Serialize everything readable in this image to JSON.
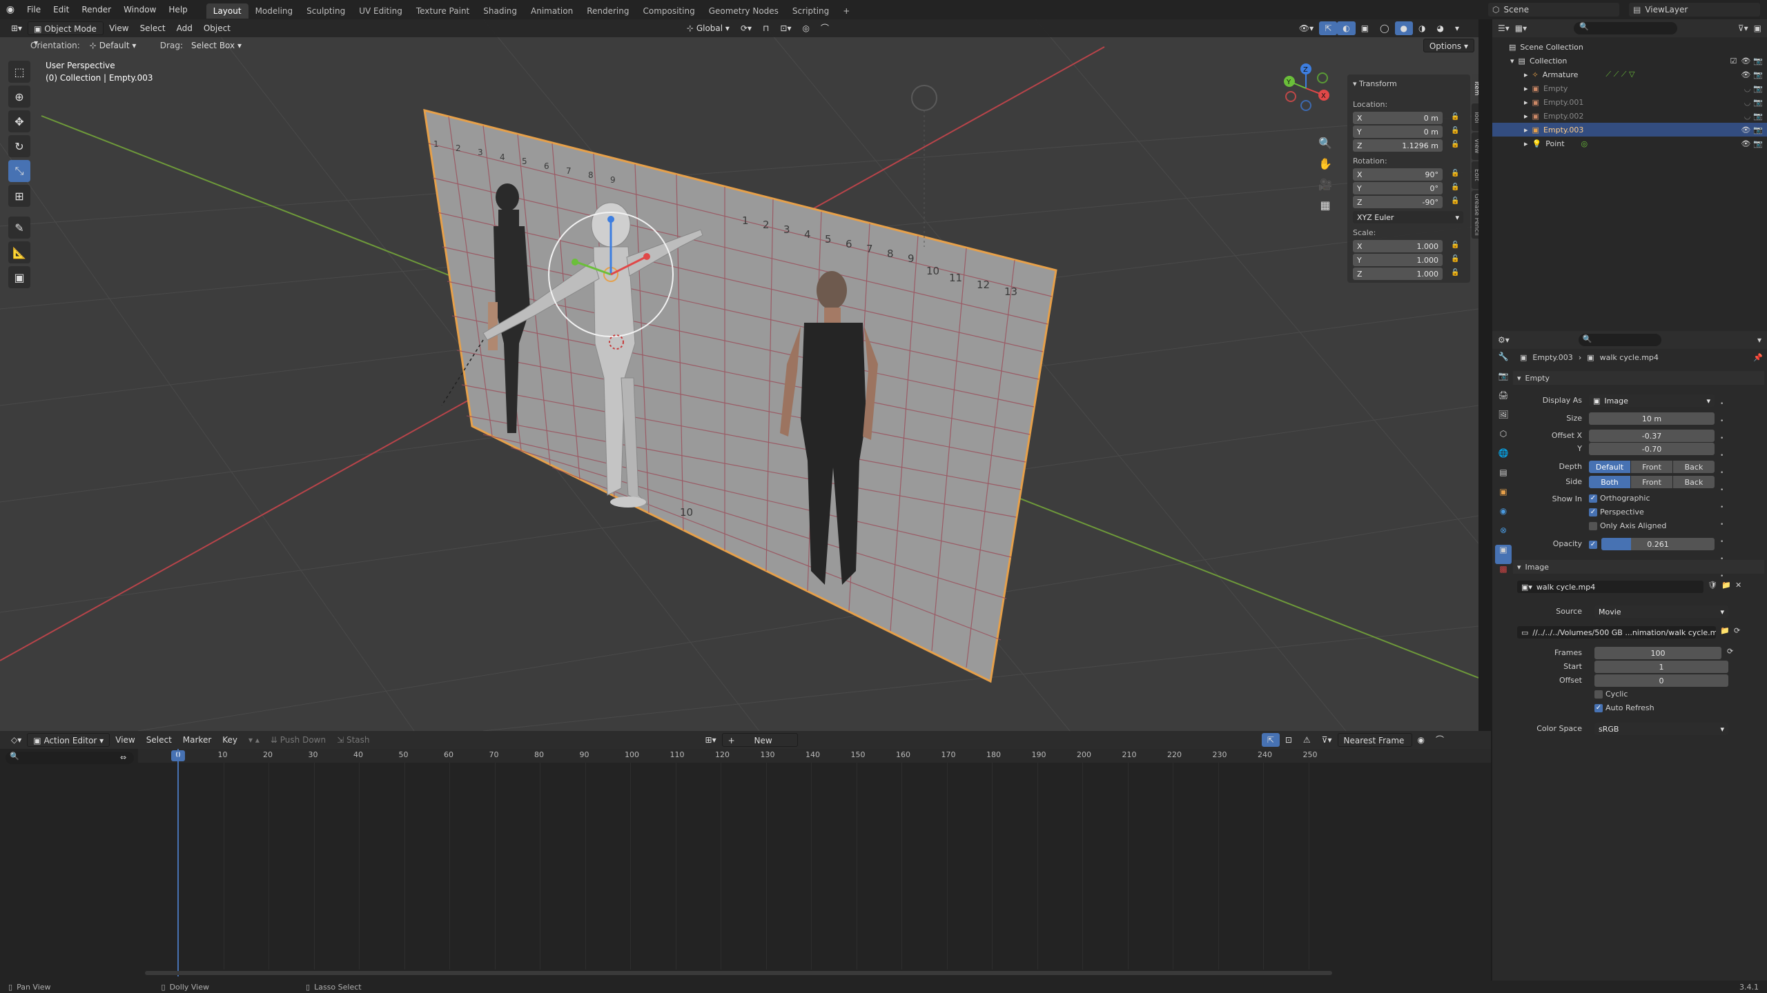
{
  "menubar": {
    "items": [
      "File",
      "Edit",
      "Render",
      "Window",
      "Help"
    ],
    "workspaces": [
      "Layout",
      "Modeling",
      "Sculpting",
      "UV Editing",
      "Texture Paint",
      "Shading",
      "Animation",
      "Rendering",
      "Compositing",
      "Geometry Nodes",
      "Scripting"
    ],
    "active_workspace": "Layout",
    "add_tab": "+",
    "scene_label": "Scene",
    "viewlayer_label": "ViewLayer"
  },
  "viewport": {
    "mode": "Object Mode",
    "menus": [
      "View",
      "Select",
      "Add",
      "Object"
    ],
    "orientation_label": "Orientation:",
    "orientation_value": "Default",
    "drag_label": "Drag:",
    "drag_value": "Select Box",
    "transform_space": "Global",
    "options_label": "Options",
    "view_name": "User Perspective",
    "view_context": "(0) Collection | Empty.003",
    "gizmo_axes": [
      "X",
      "Y",
      "Z"
    ],
    "grid_numbers_top": [
      "1",
      "2",
      "3",
      "4",
      "5",
      "6",
      "7",
      "8",
      "9",
      "10",
      "11",
      "12",
      "13"
    ],
    "grid_numbers_side": [
      "1",
      "2",
      "3",
      "4",
      "5",
      "6",
      "7",
      "8",
      "9",
      "10",
      "11",
      "12",
      "13"
    ],
    "grid_bottom_mark": "10"
  },
  "transform_panel": {
    "title": "Transform",
    "location_label": "Location:",
    "location": [
      {
        "axis": "X",
        "value": "0 m"
      },
      {
        "axis": "Y",
        "value": "0 m"
      },
      {
        "axis": "Z",
        "value": "1.1296 m"
      }
    ],
    "rotation_label": "Rotation:",
    "rotation": [
      {
        "axis": "X",
        "value": "90°"
      },
      {
        "axis": "Y",
        "value": "0°"
      },
      {
        "axis": "Z",
        "value": "-90°"
      }
    ],
    "rotation_mode": "XYZ Euler",
    "scale_label": "Scale:",
    "scale": [
      {
        "axis": "X",
        "value": "1.000"
      },
      {
        "axis": "Y",
        "value": "1.000"
      },
      {
        "axis": "Z",
        "value": "1.000"
      }
    ],
    "side_tabs": [
      "Item",
      "Tool",
      "View",
      "Edit",
      "Grease Pencil"
    ]
  },
  "outliner": {
    "root": "Scene Collection",
    "collection": "Collection",
    "items": [
      {
        "name": "Armature",
        "selected": false
      },
      {
        "name": "Empty",
        "selected": false
      },
      {
        "name": "Empty.001",
        "selected": false
      },
      {
        "name": "Empty.002",
        "selected": false
      },
      {
        "name": "Empty.003",
        "selected": true
      },
      {
        "name": "Point",
        "selected": false
      }
    ]
  },
  "properties": {
    "breadcrumb_object": "Empty.003",
    "breadcrumb_data": "walk cycle.mp4",
    "empty_section": "Empty",
    "display_as_label": "Display As",
    "display_as_value": "Image",
    "size_label": "Size",
    "size_value": "10 m",
    "offset_x_label": "Offset X",
    "offset_x_value": "-0.37",
    "offset_y_label": "Y",
    "offset_y_value": "-0.70",
    "depth_label": "Depth",
    "depth_options": [
      "Default",
      "Front",
      "Back"
    ],
    "side_label": "Side",
    "side_options": [
      "Both",
      "Front",
      "Back"
    ],
    "show_in_label": "Show In",
    "show_orthographic": "Orthographic",
    "show_perspective": "Perspective",
    "only_axis_aligned": "Only Axis Aligned",
    "opacity_label": "Opacity",
    "opacity_value": "0.261",
    "opacity_fraction": 0.261,
    "image_section": "Image",
    "image_name": "walk cycle.mp4",
    "source_label": "Source",
    "source_value": "Movie",
    "filepath": "//../../../Volumes/500 GB ...nimation/walk cycle.mp4",
    "frames_label": "Frames",
    "frames_value": "100",
    "start_label": "Start",
    "start_value": "1",
    "offset_label": "Offset",
    "offset_value": "0",
    "cyclic_label": "Cyclic",
    "auto_refresh_label": "Auto Refresh",
    "color_space_label": "Color Space",
    "color_space_value": "sRGB"
  },
  "action_editor": {
    "mode": "Action Editor",
    "menus": [
      "View",
      "Select",
      "Marker",
      "Key"
    ],
    "push_down": "Push Down",
    "stash": "Stash",
    "new_label": "New",
    "snap_mode": "Nearest Frame",
    "current_frame": "0",
    "ruler": [
      "10",
      "20",
      "30",
      "40",
      "50",
      "60",
      "70",
      "80",
      "90",
      "100",
      "110",
      "120",
      "130",
      "140",
      "150",
      "160",
      "170",
      "180",
      "190",
      "200",
      "210",
      "220",
      "230",
      "240",
      "250"
    ]
  },
  "statusbar": {
    "items": [
      "Pan View",
      "Dolly View",
      "Lasso Select"
    ],
    "version": "3.4.1"
  },
  "colors": {
    "accent": "#4772b3",
    "selection_orange": "#e6a04a",
    "viewport_bg": "#3d3d3d"
  }
}
